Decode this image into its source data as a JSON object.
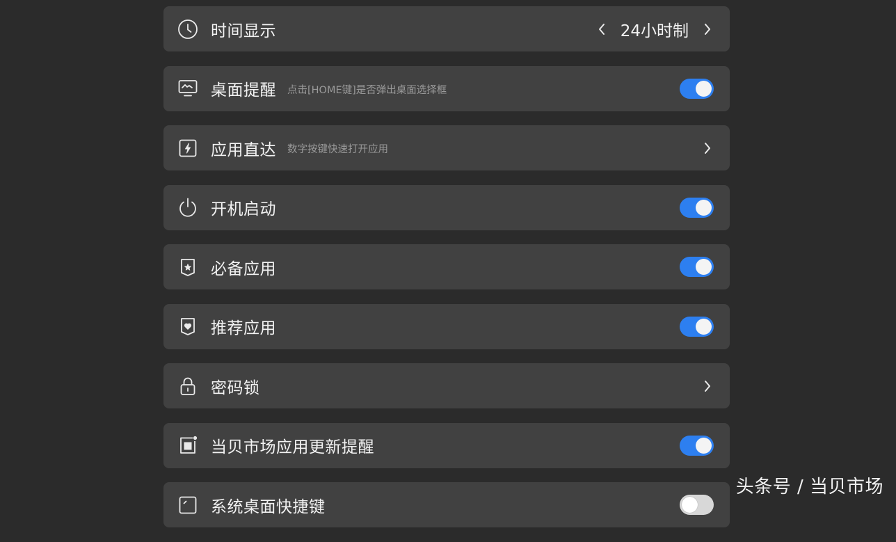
{
  "settings": [
    {
      "key": "time-display",
      "label": "时间显示",
      "hint": "",
      "control": "selector",
      "value": "24小时制",
      "icon": "clock-icon"
    },
    {
      "key": "desktop-reminder",
      "label": "桌面提醒",
      "hint": "点击[HOME键]是否弹出桌面选择框",
      "control": "toggle",
      "on": true,
      "icon": "monitor-icon"
    },
    {
      "key": "app-direct",
      "label": "应用直达",
      "hint": "数字按键快速打开应用",
      "control": "link",
      "icon": "lightning-icon"
    },
    {
      "key": "boot-start",
      "label": "开机启动",
      "hint": "",
      "control": "toggle",
      "on": true,
      "icon": "power-icon"
    },
    {
      "key": "essential-apps",
      "label": "必备应用",
      "hint": "",
      "control": "toggle",
      "on": true,
      "icon": "star-badge-icon"
    },
    {
      "key": "recommended-apps",
      "label": "推荐应用",
      "hint": "",
      "control": "toggle",
      "on": true,
      "icon": "heart-badge-icon"
    },
    {
      "key": "password-lock",
      "label": "密码锁",
      "hint": "",
      "control": "link",
      "icon": "lock-icon"
    },
    {
      "key": "update-reminder",
      "label": "当贝市场应用更新提醒",
      "hint": "",
      "control": "toggle",
      "on": true,
      "icon": "update-notify-icon"
    },
    {
      "key": "desktop-shortcut",
      "label": "系统桌面快捷键",
      "hint": "",
      "control": "toggle",
      "on": false,
      "icon": "desktop-shortcut-icon"
    }
  ],
  "watermark": "头条号 / 当贝市场",
  "colors": {
    "background": "#2b2b2b",
    "row": "#414141",
    "toggle_on": "#2d7ff0",
    "toggle_off": "#d8d8d8",
    "hint_text": "#9a9a9a"
  }
}
